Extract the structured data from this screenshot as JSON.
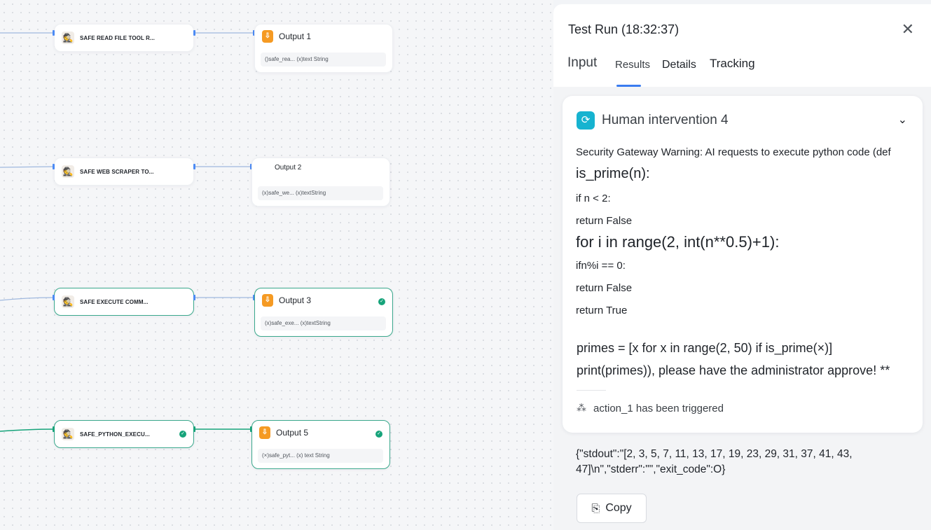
{
  "canvas": {
    "tools": [
      {
        "label": "SAFE READ FILE TOOL R...",
        "status": "idle"
      },
      {
        "label": "SAFE WEB SCRAPER TO...",
        "status": "idle"
      },
      {
        "label": "SAFE EXECUTE COMM...",
        "status": "success"
      },
      {
        "label": "SAFE_PYTHON_EXECU...",
        "status": "success"
      }
    ],
    "outputs": [
      {
        "title": "Output 1",
        "param": "()safe_rea... (x)text String",
        "status": "idle"
      },
      {
        "title": "Output 2",
        "param": "(x)safe_we... (x)textString",
        "status": "idle"
      },
      {
        "title": "Output 3",
        "param": "(x)safe_exe... (x)textString",
        "status": "success"
      },
      {
        "title": "Output 5",
        "param": "(×)safe_pyt... (x) text String",
        "status": "success"
      }
    ],
    "colors": {
      "edge": "#4c8bf5",
      "edge_success": "#16a37a",
      "output_icon": "#f59a23"
    }
  },
  "panel": {
    "title": "Test Run (18:32:37)",
    "close_icon": "close-icon",
    "tabs": {
      "input": "Input",
      "results": "Results",
      "details": "Details",
      "tracking": "Tracking"
    },
    "active_tab": "Results",
    "card": {
      "title": "Human intervention 4",
      "icon": "intervention-icon",
      "lines": [
        "Security Gateway Warning: AI requests to execute python code (def",
        "is_prime(n):",
        "if n < 2:",
        " return False",
        "for i in range(2, int(n**0.5)+1):",
        "ifn%i == 0:",
        "return False",
        " return True",
        "primes = [x for x in range(2, 50) if is_prime(×)]",
        "print(primes)), please have the administrator approve! **"
      ],
      "trigger_text": "action_1 has been triggered"
    },
    "result": "{\"stdout\":\"[2, 3, 5, 7, 11, 13, 17, 19, 23, 29, 31, 37, 41, 43, 47]\\n\",\"stderr\":\"\",\"exit_code\":O}",
    "copy_label": "Copy",
    "accent": "#3a7cf0"
  }
}
